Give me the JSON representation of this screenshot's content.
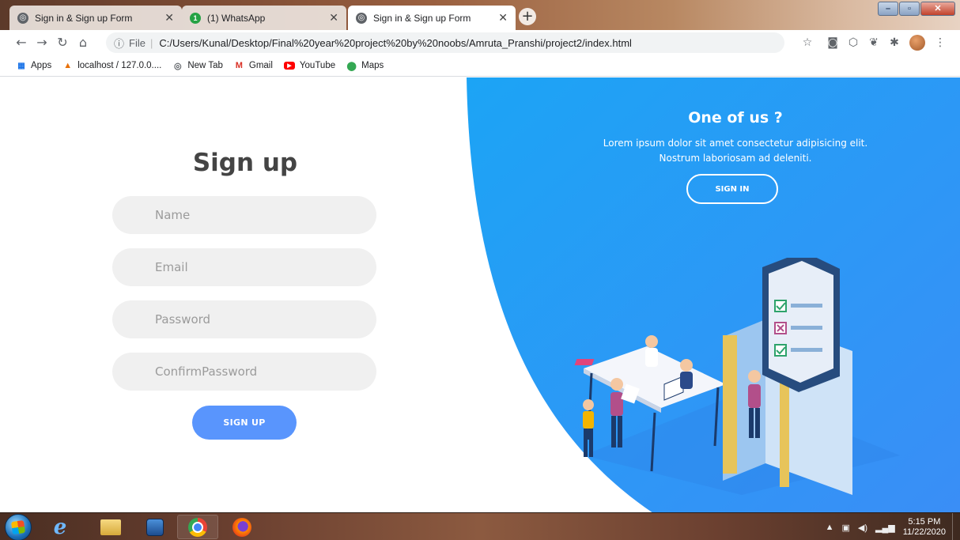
{
  "browser": {
    "tabs": [
      {
        "title": "Sign in & Sign up Form",
        "active": false,
        "favicon": "globe-icon"
      },
      {
        "title": "(1) WhatsApp",
        "active": false,
        "favicon": "whatsapp-icon",
        "badge": "1"
      },
      {
        "title": "Sign in & Sign up Form",
        "active": true,
        "favicon": "globe-icon"
      }
    ],
    "address": {
      "scheme": "File",
      "url": "C:/Users/Kunal/Desktop/Final%20year%20project%20by%20noobs/Amruta_Pranshi/project2/index.html"
    },
    "bookmarks": [
      {
        "label": "Apps",
        "icon": "apps-grid-icon"
      },
      {
        "label": "localhost / 127.0.0....",
        "icon": "phpmyadmin-icon"
      },
      {
        "label": "New Tab",
        "icon": "globe-icon"
      },
      {
        "label": "Gmail",
        "icon": "gmail-icon"
      },
      {
        "label": "YouTube",
        "icon": "youtube-icon"
      },
      {
        "label": "Maps",
        "icon": "maps-pin-icon"
      }
    ]
  },
  "signup": {
    "title": "Sign up",
    "fields": [
      {
        "placeholder": "Name",
        "type": "text"
      },
      {
        "placeholder": "Email",
        "type": "email"
      },
      {
        "placeholder": "Password",
        "type": "password"
      },
      {
        "placeholder": "ConfirmPassword",
        "type": "password"
      }
    ],
    "button_label": "SIGN UP"
  },
  "promo": {
    "heading": "One of us ?",
    "text_line1": "Lorem ipsum dolor sit amet consectetur adipisicing elit.",
    "text_line2": "Nostrum laboriosam ad deleniti.",
    "button_label": "SIGN IN"
  },
  "taskbar": {
    "time": "5:15 PM",
    "date": "11/22/2020"
  },
  "colors": {
    "accent": "#5995fd",
    "panel_gradient_start": "#1ca4f5",
    "panel_gradient_end": "#3a8ef6"
  }
}
